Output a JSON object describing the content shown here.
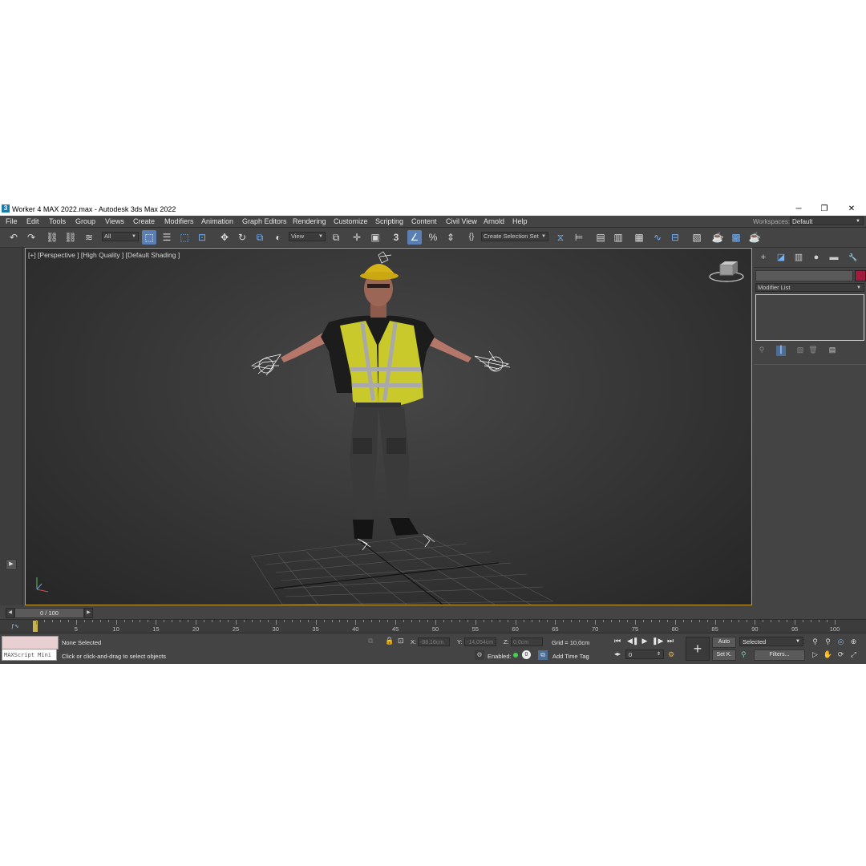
{
  "window": {
    "title": "Worker 4 MAX 2022.max - Autodesk 3ds Max 2022",
    "app_icon": "3",
    "controls": [
      "─",
      "❐",
      "✕"
    ]
  },
  "menu": [
    "File",
    "Edit",
    "Tools",
    "Group",
    "Views",
    "Create",
    "Modifiers",
    "Animation",
    "Graph Editors",
    "Rendering",
    "Customize",
    "Scripting",
    "Content",
    "Civil View",
    "Arnold",
    "Help"
  ],
  "workspaces": {
    "label": "Workspaces:",
    "value": "Default"
  },
  "toolbar": {
    "selection_filter": "All",
    "ref_coord": "View",
    "selection_set": "Create Selection Set",
    "icons": {
      "undo": "↶",
      "redo": "↷",
      "link": "⛓",
      "unlink": "⛓",
      "bind": "≋",
      "select": "⬚",
      "select_by_name": "☰",
      "rect_region": "⬚",
      "window_crossing": "⊡",
      "move": "✥",
      "rotate": "↻",
      "scale": "⧉",
      "placement": "◐",
      "pivot": "⧉",
      "manipulate": "✛",
      "keyboard": "▣",
      "snap3": "3",
      "angle_snap": "∠",
      "percent_snap": "%",
      "spinner_snap": "⇕",
      "named_sets": "{}",
      "mirror": "⧖",
      "align": "⊨",
      "layer": "▤",
      "ribbon": "▥",
      "scene_explorer": "▦",
      "curve_editor": "∿",
      "schematic": "⊟",
      "material_editor": "▧",
      "render_setup": "☕",
      "rendered_frame": "▩",
      "render": "☕"
    }
  },
  "viewport": {
    "label": "[+] [Perspective ] [High Quality ] [Default Shading ]"
  },
  "command_panel": {
    "tabs": [
      "+",
      "◪",
      "▥",
      "●",
      "▬",
      "🔧"
    ],
    "modifier_list": "Modifier List",
    "object_color": "#a01c3c",
    "stack_icons": [
      "⚲",
      "┃",
      "▧",
      "🗑",
      "▤"
    ]
  },
  "timeline": {
    "time_slider": "0 / 100",
    "ruler_labels": [
      0,
      5,
      10,
      15,
      20,
      25,
      30,
      35,
      40,
      45,
      50,
      55,
      60,
      65,
      70,
      75,
      80,
      85,
      90,
      95,
      100
    ],
    "current_frame": 0,
    "min_frame": 0,
    "max_frame": 100
  },
  "status": {
    "maxscript_mini": "MAXScript Mini",
    "selection_text": "None Selected",
    "prompt_text": "Click or click-and-drag to select objects",
    "x_label": "X:",
    "x_value": "-88,16cm",
    "y_label": "Y:",
    "y_value": "-14,054cm",
    "z_label": "Z:",
    "z_value": "0,0cm",
    "grid": "Grid = 10,0cm",
    "enabled_label": "Enabled:",
    "add_time_tag": "Add Time Tag",
    "auto": "Auto",
    "set_key": "Set K.",
    "key_mode": "Selected",
    "filters": "Filters...",
    "frame_value": "0"
  },
  "playback": [
    "⏮",
    "◀❚",
    "▶",
    "❚▶",
    "⏭"
  ]
}
